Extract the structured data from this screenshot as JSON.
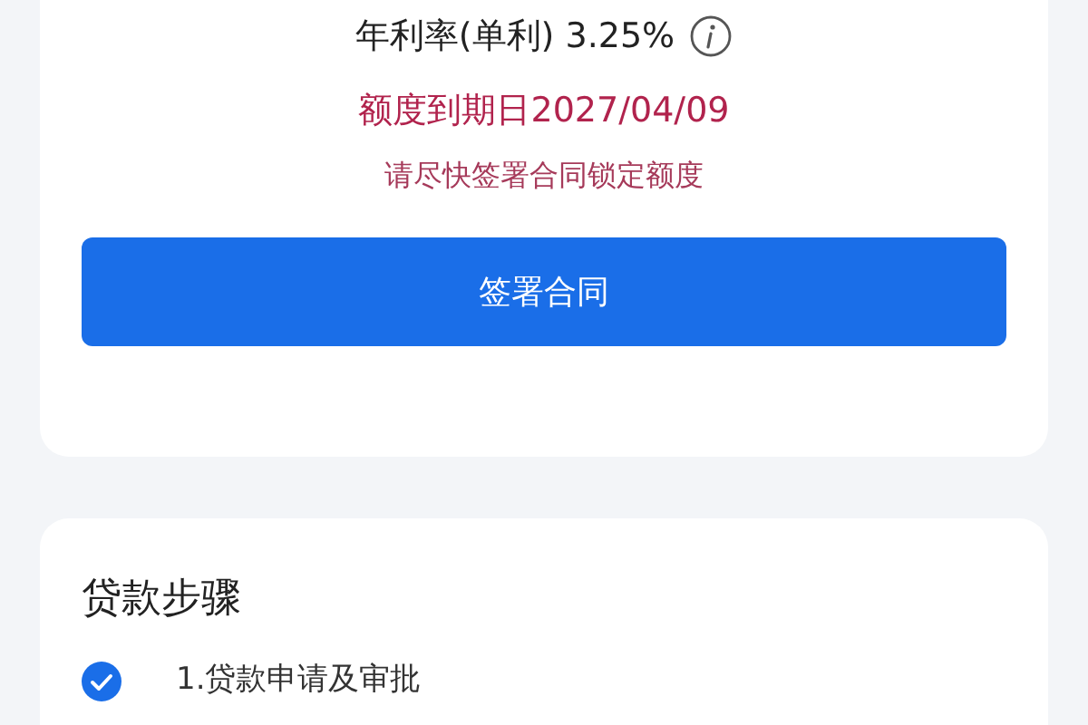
{
  "quota_card": {
    "rate_label": "年利率(单利) 3.25%",
    "expiry": "额度到期日2027/04/09",
    "hint": "请尽快签署合同锁定额度",
    "sign_button": "签署合同"
  },
  "steps_card": {
    "title": "贷款步骤",
    "steps": [
      {
        "label": "1.贷款申请及审批",
        "checked": true
      }
    ]
  }
}
